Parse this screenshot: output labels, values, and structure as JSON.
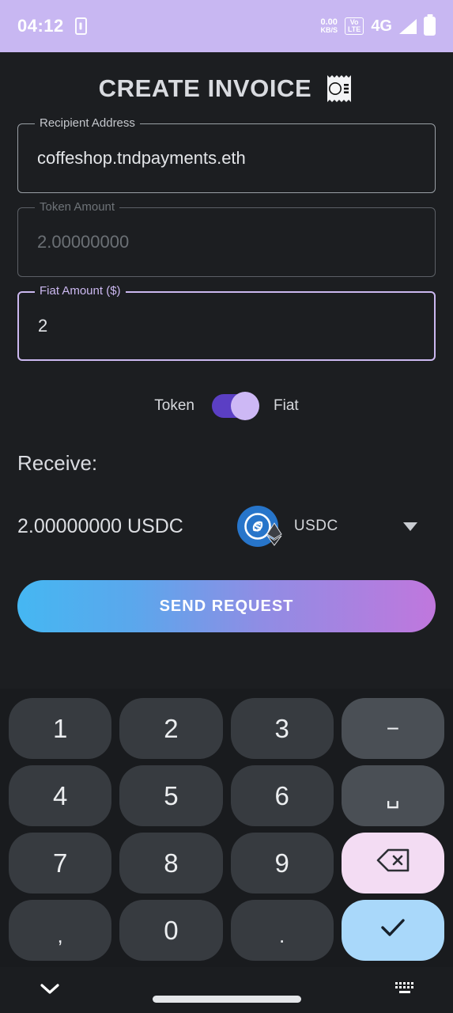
{
  "status_bar": {
    "time": "04:12",
    "vibrate_icon": "phone-vibrate-icon",
    "data_rate_value": "0.00",
    "data_rate_unit": "KB/S",
    "volte_top": "Vo",
    "volte_bottom": "LTE",
    "network": "4G",
    "signal_icon": "signal-bars-icon",
    "battery_icon": "battery-full-icon",
    "background_color": "#c8b7f2"
  },
  "header": {
    "title": "CREATE INVOICE",
    "icon": "receipt-invoice-icon"
  },
  "form": {
    "recipient": {
      "label": "Recipient Address",
      "value": "coffeshop.tndpayments.eth",
      "state": "filled"
    },
    "token_amount": {
      "label": "Token Amount",
      "placeholder": "2.00000000",
      "value": "",
      "state": "disabled"
    },
    "fiat_amount": {
      "label": "Fiat Amount ($)",
      "value": "2",
      "state": "focused",
      "focus_color": "#cbb8f0"
    }
  },
  "mode_toggle": {
    "left_label": "Token",
    "right_label": "Fiat",
    "selected": "Fiat",
    "track_color": "#5b3fc4",
    "thumb_color": "#cdb8f5"
  },
  "receive": {
    "label": "Receive:",
    "amount": "2.00000000 USDC",
    "coin_icon": "usdc-coin-icon",
    "coin_color": "#2775ca",
    "network_badge_icon": "ethereum-badge-icon",
    "dropdown_value": "USDC",
    "dropdown_caret_icon": "chevron-down-icon"
  },
  "primary_action": {
    "label": "SEND REQUEST",
    "gradient_from": "#45b7f2",
    "gradient_to": "#c077dd"
  },
  "keyboard": {
    "rows": [
      [
        {
          "label": "1",
          "name": "key-1",
          "type": "digit"
        },
        {
          "label": "2",
          "name": "key-2",
          "type": "digit"
        },
        {
          "label": "3",
          "name": "key-3",
          "type": "digit"
        },
        {
          "label": "−",
          "name": "key-minus",
          "type": "fn"
        }
      ],
      [
        {
          "label": "4",
          "name": "key-4",
          "type": "digit"
        },
        {
          "label": "5",
          "name": "key-5",
          "type": "digit"
        },
        {
          "label": "6",
          "name": "key-6",
          "type": "digit"
        },
        {
          "label": "␣",
          "name": "key-space",
          "type": "fn"
        }
      ],
      [
        {
          "label": "7",
          "name": "key-7",
          "type": "digit"
        },
        {
          "label": "8",
          "name": "key-8",
          "type": "digit"
        },
        {
          "label": "9",
          "name": "key-9",
          "type": "digit"
        },
        {
          "label": "",
          "name": "key-backspace",
          "type": "backspace"
        }
      ],
      [
        {
          "label": ",",
          "name": "key-comma",
          "type": "comma"
        },
        {
          "label": "0",
          "name": "key-0",
          "type": "digit"
        },
        {
          "label": ".",
          "name": "key-period",
          "type": "dot"
        },
        {
          "label": "",
          "name": "key-enter",
          "type": "enter"
        }
      ]
    ],
    "backspace_color": "#f3dcf3",
    "enter_color": "#a9d8fa"
  },
  "nav_bar": {
    "hide_keyboard_icon": "chevron-down-icon",
    "switch_keyboard_icon": "keyboard-icon",
    "home_indicator": "home-indicator"
  }
}
